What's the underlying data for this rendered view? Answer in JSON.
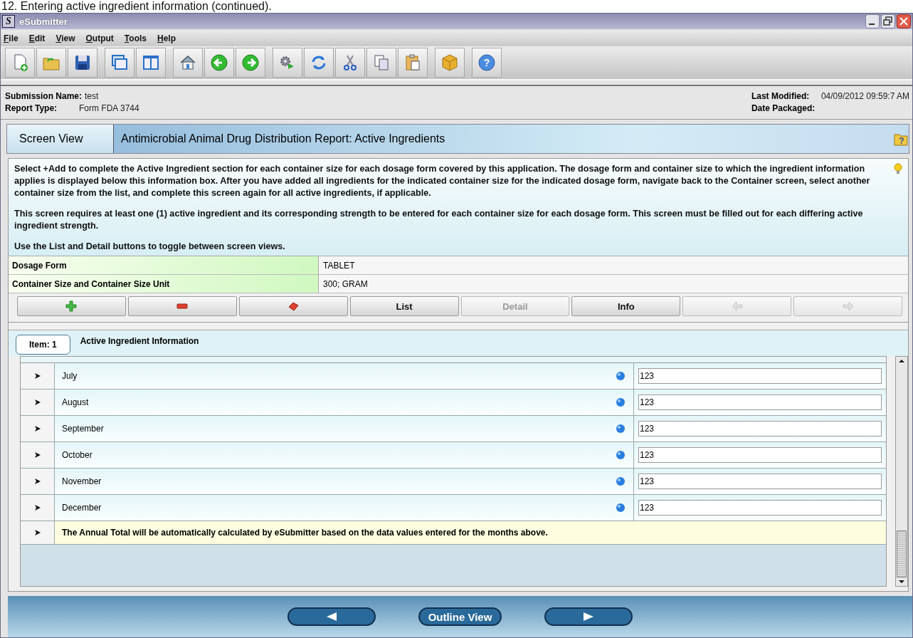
{
  "caption": "12. Entering active ingredient information (continued).",
  "window": {
    "title": "eSubmitter",
    "app_letter": "S"
  },
  "menu": [
    "File",
    "Edit",
    "View",
    "Output",
    "Tools",
    "Help"
  ],
  "toolbar": [
    [
      {
        "kind": "new-file"
      },
      {
        "kind": "open-folder"
      },
      {
        "kind": "save"
      }
    ],
    [
      {
        "kind": "cascade-windows"
      },
      {
        "kind": "split-view"
      }
    ],
    [
      {
        "kind": "home"
      },
      {
        "kind": "back"
      },
      {
        "kind": "forward"
      }
    ],
    [
      {
        "kind": "run"
      },
      {
        "kind": "refresh"
      },
      {
        "kind": "cut"
      },
      {
        "kind": "copy"
      },
      {
        "kind": "paste"
      }
    ],
    [
      {
        "kind": "package"
      }
    ],
    [
      {
        "kind": "help",
        "glyph": "?"
      }
    ]
  ],
  "submission": {
    "left": [
      {
        "label": "Submission Name:",
        "value": "test"
      },
      {
        "label": "Report Type:",
        "value": "Form FDA 3744"
      }
    ],
    "right": [
      {
        "label": "Last Modified:",
        "value": "04/09/2012 09:59:7 AM"
      },
      {
        "label": "Date Packaged:"
      }
    ]
  },
  "section": {
    "view_label": "Screen View",
    "title": "Antimicrobial Animal Drug Distribution Report: Active Ingredients",
    "help_glyph": "?"
  },
  "instructions": [
    "Select +Add to complete the Active Ingredient section for each container size for each dosage form covered by this application. The dosage form and container size to which the ingredient information applies is displayed below this information box. After you have added all ingredients for the indicated container size for the indicated dosage form, navigate back to the Container screen, select another container size from the list, and complete this screen again for all active ingredients, if applicable.",
    "This screen requires at least one (1) active ingredient and its corresponding strength to be entered for each container size for each dosage form. This screen must be filled out for each differing active ingredient strength.",
    "Use the List and Detail buttons to toggle between screen views."
  ],
  "context": [
    {
      "label": "Dosage Form",
      "value": "TABLET"
    },
    {
      "label": "Container Size and Container Size Unit",
      "value": "300; GRAM"
    }
  ],
  "buttons": [
    {
      "kind": "add",
      "disabled": false
    },
    {
      "kind": "remove",
      "disabled": false
    },
    {
      "kind": "erase",
      "disabled": false
    },
    {
      "kind": "text",
      "label": "List",
      "disabled": false
    },
    {
      "kind": "text",
      "label": "Detail",
      "disabled": true
    },
    {
      "kind": "text",
      "label": "Info",
      "disabled": false
    },
    {
      "kind": "prev",
      "disabled": true
    },
    {
      "kind": "next",
      "disabled": true
    }
  ],
  "item": {
    "tab": "Item: 1",
    "title": "Active Ingredient Information"
  },
  "rows": [
    {
      "kind": "field",
      "label": "July",
      "required": true,
      "value": "123"
    },
    {
      "kind": "field",
      "label": "August",
      "required": true,
      "value": "123"
    },
    {
      "kind": "field",
      "label": "September",
      "required": true,
      "value": "123"
    },
    {
      "kind": "field",
      "label": "October",
      "required": true,
      "value": "123"
    },
    {
      "kind": "field",
      "label": "November",
      "required": true,
      "value": "123"
    },
    {
      "kind": "field",
      "label": "December",
      "required": true,
      "value": "123"
    },
    {
      "kind": "note",
      "label": "The Annual Total will be automatically calculated by eSubmitter based on the data values entered for the months above."
    }
  ],
  "footer": {
    "center": "Outline View"
  }
}
